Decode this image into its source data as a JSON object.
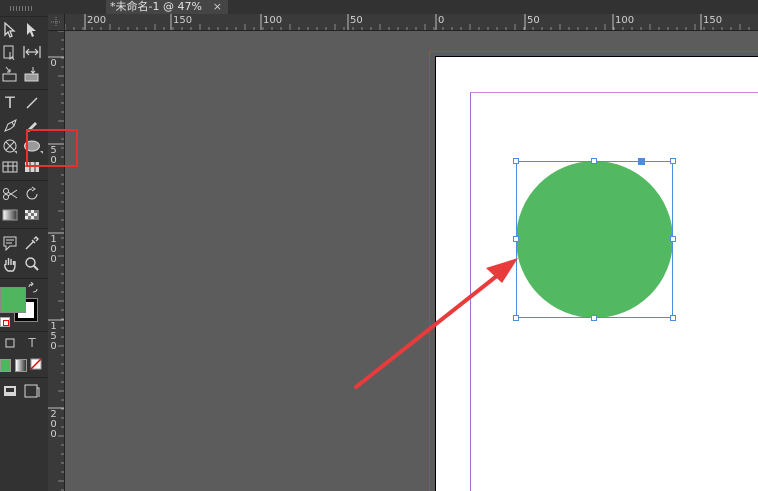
{
  "document_tab": {
    "title": "*未命名-1 @ 47%",
    "close_glyph": "×"
  },
  "ruler_horizontal": [
    "200",
    "150",
    "100",
    "50",
    "0",
    "50",
    "100",
    "150"
  ],
  "ruler_vertical": [
    "0",
    "5\n0",
    "1\n0\n0",
    "1\n5\n0",
    "2\n0\n0"
  ],
  "toolbar": {
    "tools": [
      "selection-tool",
      "direct-selection-tool",
      "page-tool",
      "gap-tool",
      "content-collector-tool",
      "content-placer-tool",
      "type-tool",
      "line-tool",
      "pen-tool",
      "pencil-tool",
      "rectangle-frame-tool",
      "ellipse-tool",
      "table-tool",
      "grid-tool",
      "scissors-tool",
      "free-transform-tool",
      "gradient-swatch-tool",
      "gradient-feather-tool",
      "note-tool",
      "eyedropper-tool",
      "hand-tool",
      "zoom-tool"
    ],
    "type_tool_glyph": "T",
    "formatting_text_glyph": "T",
    "fill_color": "#4fb55e",
    "stroke_color": "#000000"
  },
  "shape": {
    "kind": "ellipse",
    "fill_color": "#53b862",
    "selected": true
  },
  "annotation": {
    "highlight_color": "#e6322e",
    "arrow_color": "#e83b3b"
  }
}
